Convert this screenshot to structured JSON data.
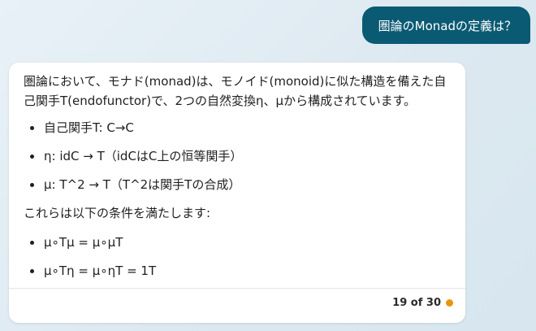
{
  "conversation": {
    "user_message": "圏論のMonadの定義は？",
    "bot": {
      "intro": "圏論において、モナド(monad)は、モノイド(monoid)に似た構造を備えた自己関手T(endofunctor)で、2つの自然変換η、μから構成されています。",
      "components": [
        "自己関手T: C→C",
        "η: idC → T（idCはC上の恒等関手）",
        "μ: T^2 → T（T^2は関手Tの合成）"
      ],
      "conditions_intro": "これらは以下の条件を満たします:",
      "conditions": [
        "μ∘Tμ = μ∘μT",
        "μ∘Tη = μ∘ηT = 1T"
      ]
    },
    "footer": {
      "counter": "19 of 30",
      "status_color": "#e8960c"
    }
  },
  "colors": {
    "user_bubble": "#0b5a73",
    "card_bg": "#ffffff"
  }
}
